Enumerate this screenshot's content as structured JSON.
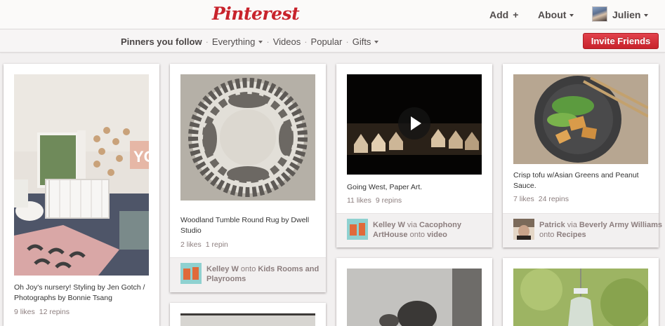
{
  "header": {
    "logo": "Pinterest",
    "add_label": "Add",
    "add_plus": "+",
    "about_label": "About",
    "user_name": "Julien"
  },
  "subnav": {
    "items": [
      "Pinners you follow",
      "Everything",
      "Videos",
      "Popular",
      "Gifts"
    ],
    "separator": "·",
    "invite_label": "Invite Friends"
  },
  "pins": [
    {
      "description": "Oh Joy's nursery! Styling by Jen Gotch / Photographs by Bonnie Tsang",
      "likes": "9 likes",
      "repins": "12 repins"
    },
    {
      "description": "Woodland Tumble Round Rug by Dwell Studio",
      "likes": "2 likes",
      "repins": "1 repin",
      "attribution": {
        "user": "Kelley W",
        "onto": "onto",
        "board": "Kids Rooms and Playrooms"
      }
    },
    {
      "description": "Going West, Paper Art.",
      "likes": "11 likes",
      "repins": "9 repins",
      "attribution": {
        "user": "Kelley W",
        "via": "via",
        "source": "Cacophony ArtHouse",
        "onto": "onto",
        "board": "video"
      }
    },
    {
      "description": "Crisp tofu w/Asian Greens and Peanut Sauce.",
      "likes": "7 likes",
      "repins": "24 repins",
      "attribution": {
        "user": "Patrick",
        "via": "via",
        "source": "Beverly Army Williams",
        "onto": "onto",
        "board": "Recipes"
      }
    }
  ],
  "colors": {
    "brand": "#c8232c",
    "background": "#f2f0f0"
  }
}
